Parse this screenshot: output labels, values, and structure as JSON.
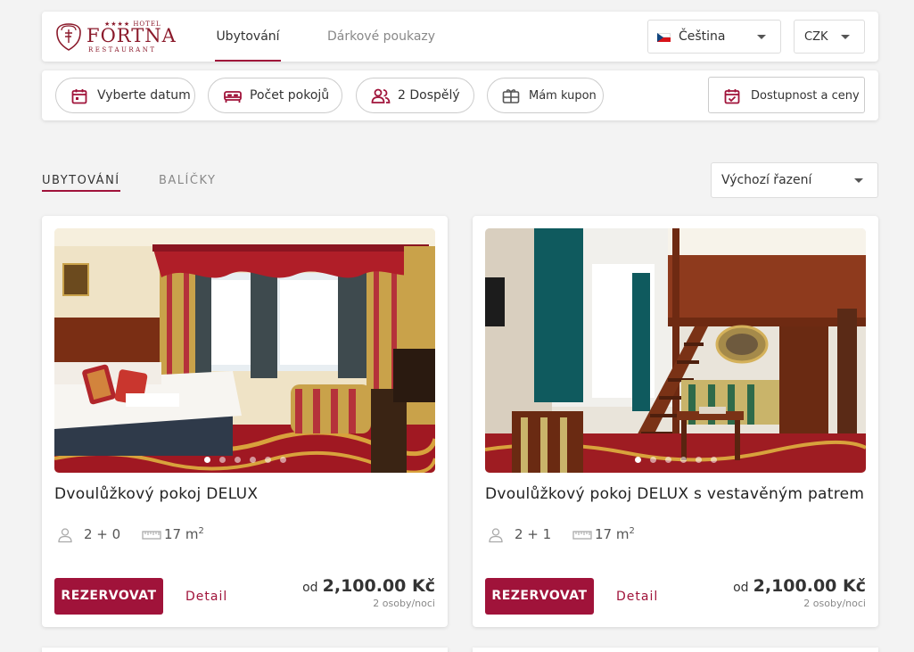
{
  "logo": {
    "stars": "★★★★ HOTEL",
    "name": "FORTNA",
    "sub": "RESTAURANT"
  },
  "nav": {
    "tabs": [
      {
        "label": "Ubytování",
        "active": true
      },
      {
        "label": "Dárkové poukazy",
        "active": false
      }
    ]
  },
  "language": {
    "value": "Čeština",
    "flag": "czech-flag"
  },
  "currency": {
    "value": "CZK"
  },
  "filters": {
    "date": "Vyberte datum",
    "rooms": "Počet pokojů",
    "guests": "2 Dospělý",
    "coupon": "Mám kupon",
    "availability": "Dostupnost a ceny"
  },
  "content_tabs": [
    {
      "label": "UBYTOVÁNÍ",
      "active": true
    },
    {
      "label": "BALÍČKY",
      "active": false
    }
  ],
  "sort": {
    "value": "Výchozí řazení"
  },
  "rooms": [
    {
      "name": "Dvoulůžkový pokoj DELUX",
      "guests": "2 + 0",
      "size": "17 m",
      "size_sup": "2",
      "reserve": "REZERVOVAT",
      "detail": "Detail",
      "price_prefix": "od",
      "price": "2,100.00 Kč",
      "price_note": "2 osoby/noci",
      "dots": 6,
      "active_dot": 0
    },
    {
      "name": "Dvoulůžkový pokoj DELUX s vestavěným patrem",
      "guests": "2 + 1",
      "size": "17 m",
      "size_sup": "2",
      "reserve": "REZERVOVAT",
      "detail": "Detail",
      "price_prefix": "od",
      "price": "2,100.00 Kč",
      "price_note": "2 osoby/noci",
      "dots": 6,
      "active_dot": 0
    }
  ],
  "colors": {
    "accent": "#a0133a",
    "background": "#f3f3f3"
  }
}
